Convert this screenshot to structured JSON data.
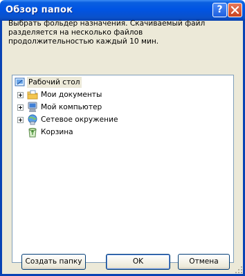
{
  "window": {
    "title": "Обзор папок",
    "help_glyph": "?"
  },
  "description": {
    "lines": [
      "Выбрать фольдер назначения. Скачиваемый файл",
      "разделяется на несколько файлов",
      "продолжительностью каждый 10 мин."
    ]
  },
  "tree": {
    "root": {
      "label": "Рабочий стол",
      "icon": "desktop-icon"
    },
    "items": [
      {
        "label": "Мои документы",
        "icon": "my-documents-icon",
        "expandable": true
      },
      {
        "label": "Мой компьютер",
        "icon": "my-computer-icon",
        "expandable": true
      },
      {
        "label": "Сетевое окружение",
        "icon": "network-icon",
        "expandable": true
      },
      {
        "label": "Корзина",
        "icon": "recycle-bin-icon",
        "expandable": false
      }
    ]
  },
  "buttons": {
    "new_folder": "Создать папку",
    "ok": "OK",
    "cancel": "Отмена"
  },
  "colors": {
    "title_bar": "#0054e3",
    "dialog_bg": "#ece9d8",
    "tree_border": "#7f9db9",
    "close_button": "#c8431f"
  }
}
